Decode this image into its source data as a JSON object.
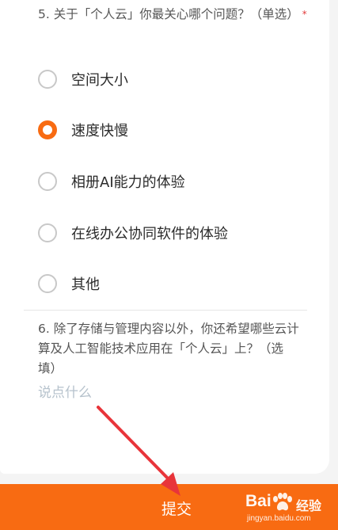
{
  "question5": {
    "title": "5. 关于「个人云」你最关心哪个问题？（单选）",
    "required_mark": "*",
    "options": [
      {
        "label": "空间大小",
        "selected": false
      },
      {
        "label": "速度快慢",
        "selected": true
      },
      {
        "label": "相册AI能力的体验",
        "selected": false
      },
      {
        "label": "在线办公协同软件的体验",
        "selected": false
      },
      {
        "label": "其他",
        "selected": false
      }
    ]
  },
  "question6": {
    "title": "6. 除了存储与管理内容以外，你还希望哪些云计算及人工智能技术应用在「个人云」上？（选填）",
    "placeholder": "说点什么"
  },
  "footer": {
    "submit_label": "提交"
  },
  "watermark": {
    "brand": "Bai",
    "brand_cn": "经验",
    "url": "jingyan.baidu.com"
  },
  "colors": {
    "accent": "#f86b12",
    "annotation_arrow": "#e8343a",
    "placeholder": "#b6c2cc"
  }
}
